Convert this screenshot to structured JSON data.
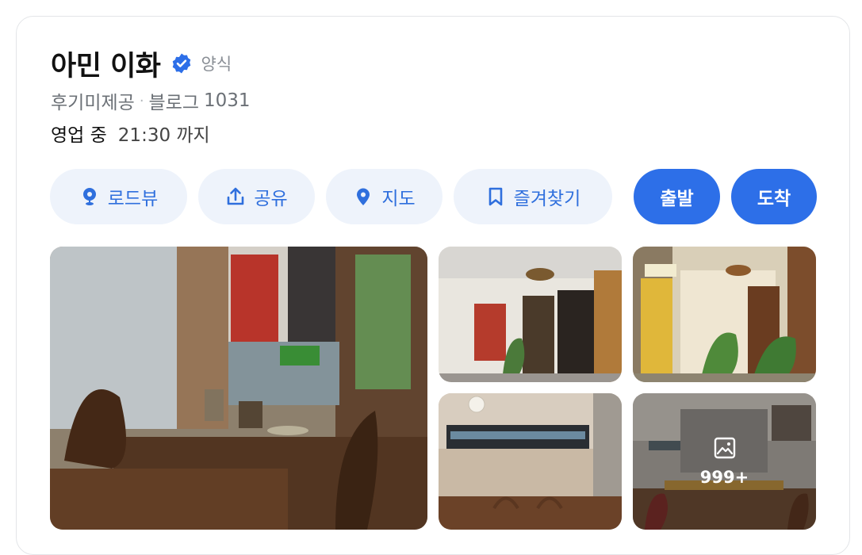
{
  "place": {
    "name": "아민 이화",
    "category": "양식",
    "verified_icon": "verified-badge-icon"
  },
  "meta": {
    "reviews_label": "후기미제공",
    "separator": "·",
    "blog_label": "블로그",
    "blog_count": "1031"
  },
  "hours": {
    "status": "영업 중",
    "until": "21:30 까지"
  },
  "actions": [
    {
      "label": "로드뷰",
      "icon": "roadview-pin-icon"
    },
    {
      "label": "공유",
      "icon": "share-upload-icon"
    },
    {
      "label": "지도",
      "icon": "map-pin-icon"
    },
    {
      "label": "즐겨찾기",
      "icon": "bookmark-icon"
    },
    {
      "label": "출발",
      "icon": ""
    },
    {
      "label": "도착",
      "icon": ""
    }
  ],
  "gallery": {
    "more_count": "999+",
    "more_icon": "photo-gallery-icon"
  },
  "colors": {
    "accent": "#2d6fe8",
    "pill_bg": "#eef3fb",
    "pill_text": "#2f6fdd"
  }
}
